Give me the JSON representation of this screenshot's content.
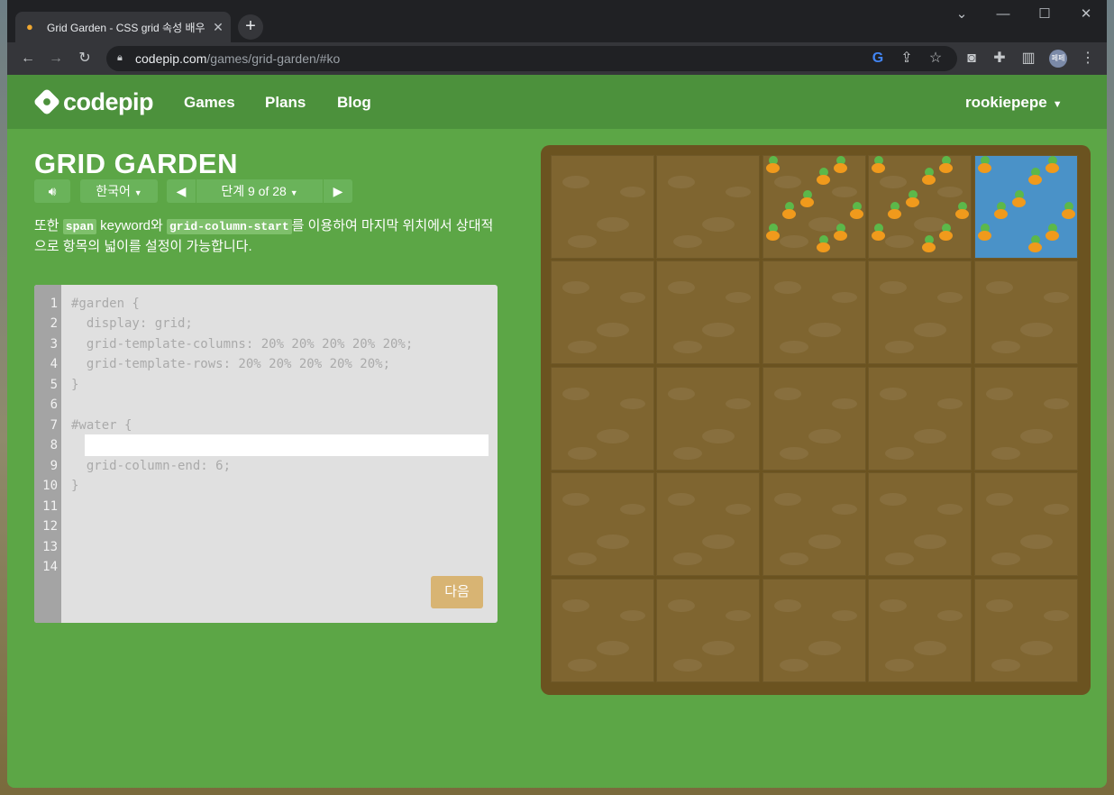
{
  "browser": {
    "tab_title": "Grid Garden - CSS grid 속성 배우기",
    "favicon": "carrot-icon",
    "url_host": "codepip.com",
    "url_path": "/games/grid-garden/#ko",
    "profile_initials": "페페"
  },
  "site": {
    "logo_text": "codepip",
    "nav": [
      "Games",
      "Plans",
      "Blog"
    ],
    "username": "rookiepepe"
  },
  "game": {
    "title": "GRID GARDEN",
    "language": "한국어",
    "level_label": "단계 9 of 28",
    "instruction": {
      "prefix": "또한",
      "code1": "span",
      "middle": "keyword와",
      "code2": "grid-column-start",
      "suffix": "를 이용하여 마지막 위치에서 상대적으로 항목의 넓이를 설정이 가능합니다."
    },
    "editor": {
      "line_numbers": [
        "1",
        "2",
        "3",
        "4",
        "5",
        "6",
        "7",
        "8",
        "9",
        "10",
        "11",
        "12",
        "13",
        "14"
      ],
      "lines": [
        "#garden {",
        "  display: grid;",
        "  grid-template-columns: 20% 20% 20% 20% 20%;",
        "  grid-template-rows: 20% 20% 20% 20% 20%;",
        "}",
        "",
        "#water {",
        "",
        "  grid-column-end: 6;",
        "}"
      ],
      "input_value": "",
      "next_label": "다음"
    },
    "garden": {
      "columns": 5,
      "rows": 5,
      "carrot_cells": [
        [
          0,
          2
        ],
        [
          0,
          3
        ],
        [
          0,
          4
        ]
      ],
      "water_cells": [
        [
          0,
          4
        ]
      ]
    }
  },
  "colors": {
    "page_green": "#5ca646",
    "nav_green": "#4c913c",
    "soil": "#7f6530",
    "water": "#4a92c8",
    "carrot": "#f09a1c"
  }
}
